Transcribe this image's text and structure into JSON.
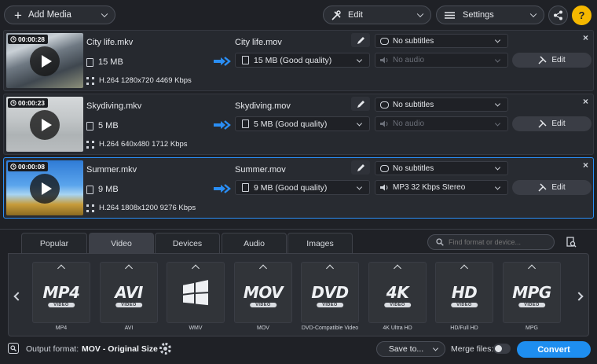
{
  "toolbar": {
    "add_media": "Add Media",
    "edit": "Edit",
    "settings": "Settings",
    "help": "?"
  },
  "files": [
    {
      "duration": "00:00:28",
      "name": "City life.mkv",
      "size": "15 MB",
      "codec": "H.264 1280x720 4469 Kbps",
      "output_name": "City life.mov",
      "output_size": "15 MB (Good quality)",
      "subtitles": "No subtitles",
      "audio": "No audio",
      "edit": "Edit"
    },
    {
      "duration": "00:00:23",
      "name": "Skydiving.mkv",
      "size": "5 MB",
      "codec": "H.264 640x480 1712 Kbps",
      "output_name": "Skydiving.mov",
      "output_size": "5 MB (Good quality)",
      "subtitles": "No subtitles",
      "audio": "No audio",
      "edit": "Edit"
    },
    {
      "duration": "00:00:08",
      "name": "Summer.mkv",
      "size": "9 MB",
      "codec": "H.264 1808x1200 9276 Kbps",
      "output_name": "Summer.mov",
      "output_size": "9 MB (Good quality)",
      "subtitles": "No subtitles",
      "audio": "MP3 32 Kbps Stereo",
      "edit": "Edit"
    }
  ],
  "tabs": [
    "Popular",
    "Video",
    "Devices",
    "Audio",
    "Images"
  ],
  "active_tab": "Video",
  "search": {
    "placeholder": "Find format or device..."
  },
  "formats": [
    {
      "logo": "MP4",
      "sub": "VIDEO",
      "label": "MP4"
    },
    {
      "logo": "AVI",
      "sub": "VIDEO",
      "label": "AVI"
    },
    {
      "logo": "",
      "sub": "",
      "label": "WMV"
    },
    {
      "logo": "MOV",
      "sub": "VIDEO",
      "label": "MOV"
    },
    {
      "logo": "DVD",
      "sub": "VIDEO",
      "label": "DVD-Compatible Video"
    },
    {
      "logo": "4K",
      "sub": "VIDEO",
      "label": "4K Ultra HD"
    },
    {
      "logo": "HD",
      "sub": "VIDEO",
      "label": "HD/Full HD"
    },
    {
      "logo": "MPG",
      "sub": "VIDEO",
      "label": "MPG"
    }
  ],
  "footer": {
    "output_label": "Output format:",
    "output_value": "MOV - Original Size",
    "save_to": "Save to...",
    "merge_label": "Merge files:",
    "convert": "Convert"
  },
  "colors": {
    "accent": "#2a8ef5",
    "convert": "#1e8ef0"
  }
}
